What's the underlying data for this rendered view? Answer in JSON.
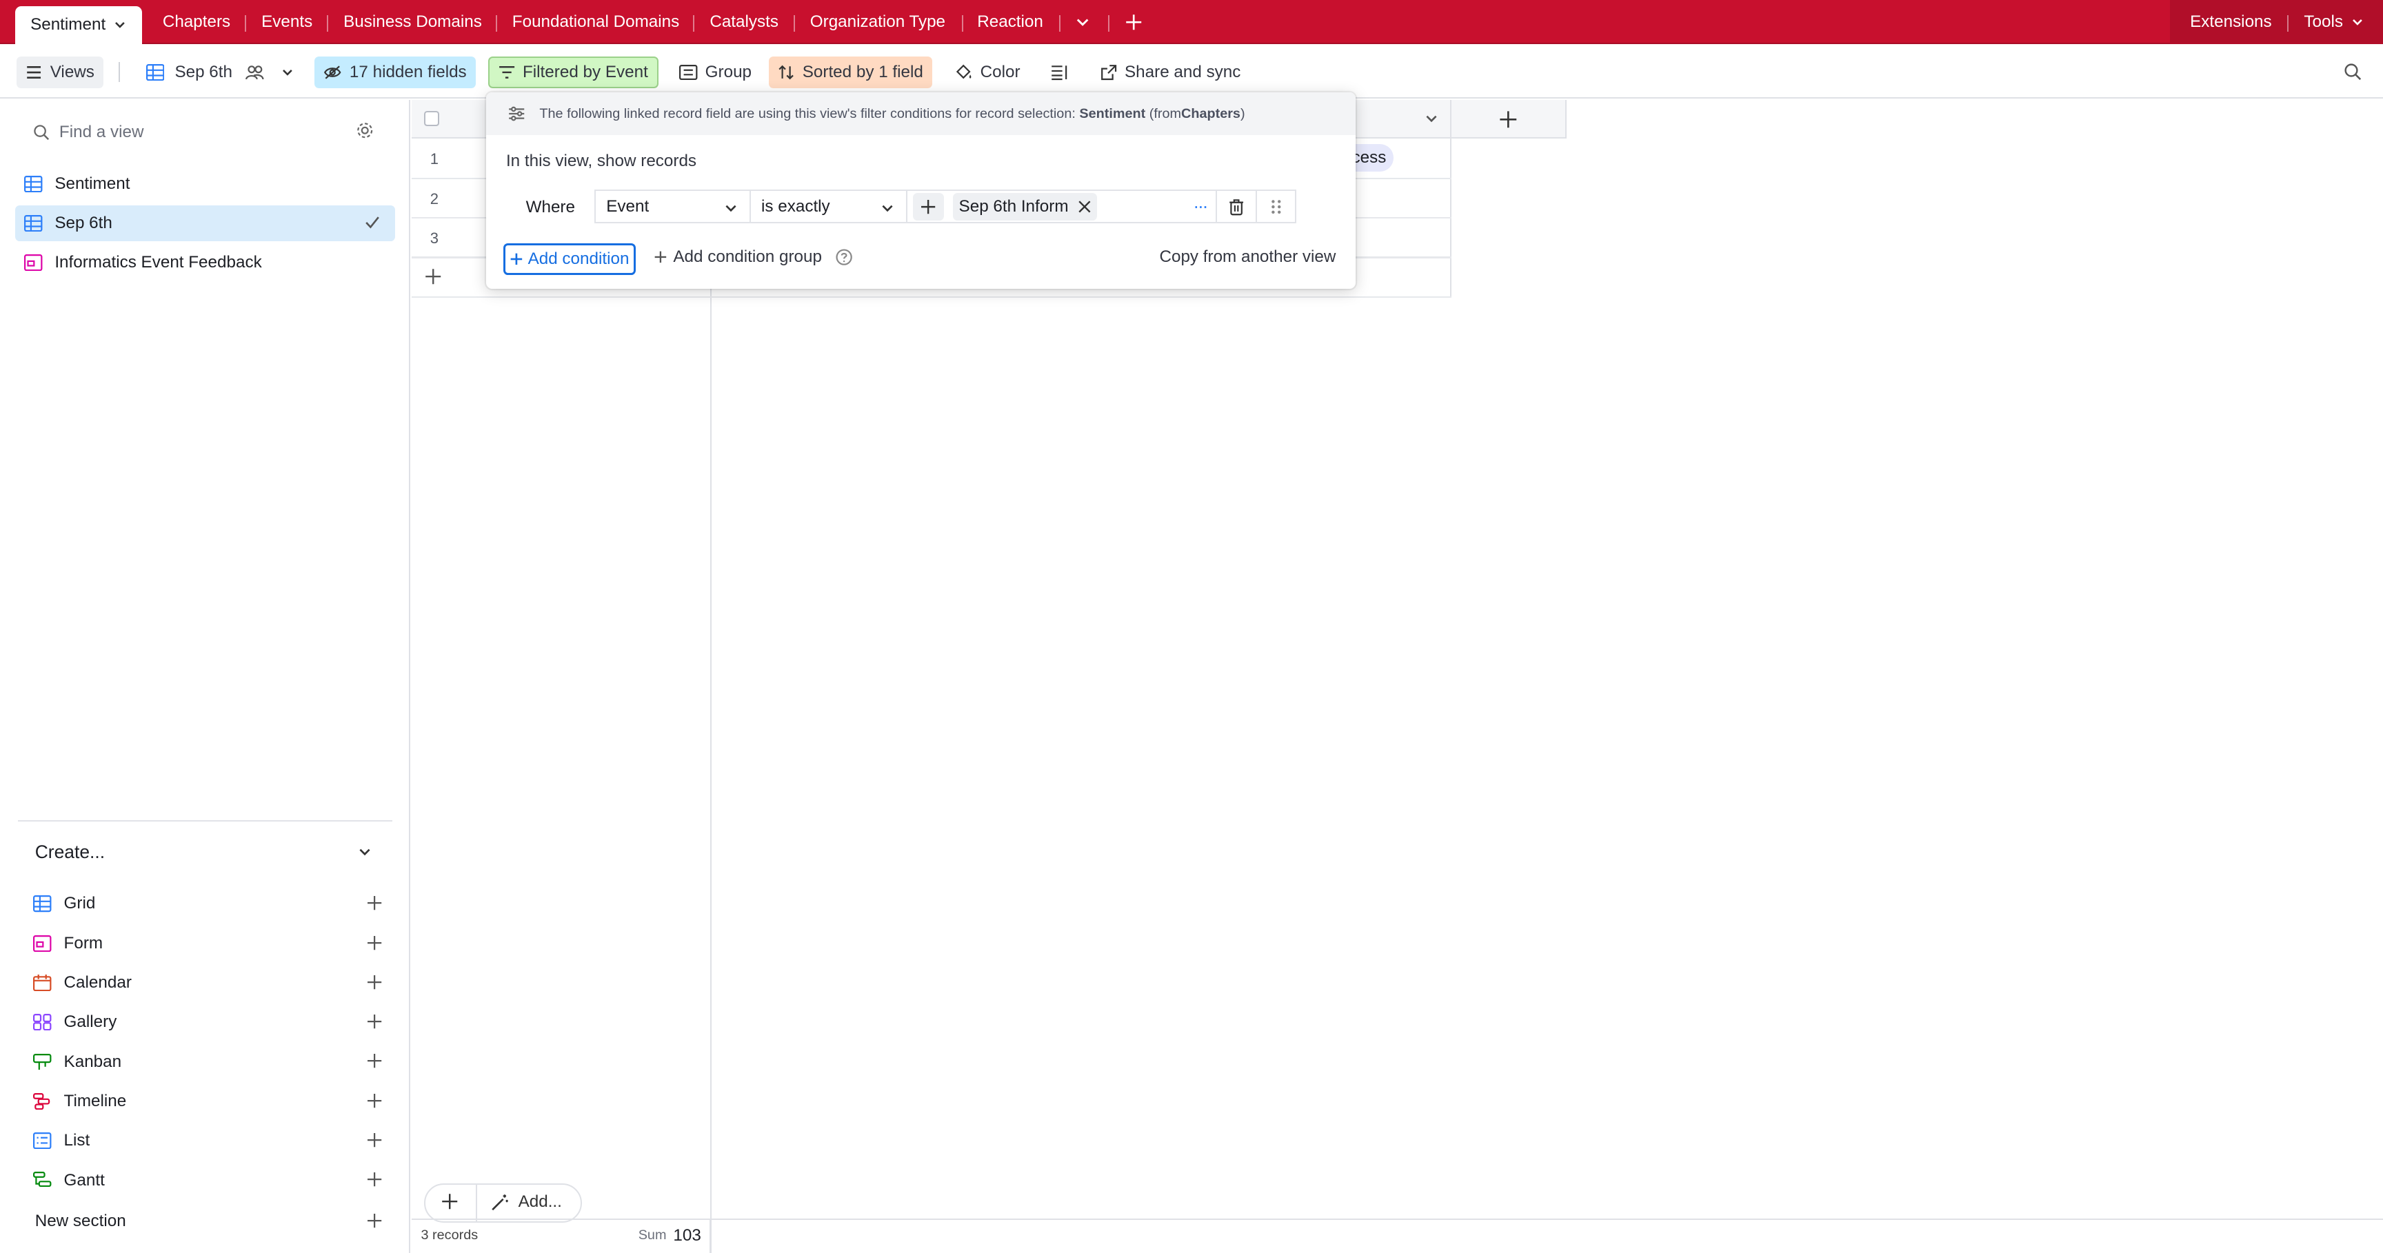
{
  "tabs": {
    "active": "Sentiment",
    "items": [
      "Chapters",
      "Events",
      "Business Domains",
      "Foundational Domains",
      "Catalysts",
      "Organization Type",
      "Reaction"
    ],
    "extensions": "Extensions",
    "tools": "Tools"
  },
  "toolbar": {
    "views": "Views",
    "current_view": "Sep 6th",
    "hidden_fields": "17 hidden fields",
    "filtered": "Filtered by Event",
    "group": "Group",
    "sorted": "Sorted by 1 field",
    "color": "Color",
    "share": "Share and sync"
  },
  "sidebar": {
    "search_placeholder": "Find a view",
    "views": [
      {
        "label": "Sentiment",
        "icon": "grid-icon",
        "selected": false
      },
      {
        "label": "Sep 6th",
        "icon": "grid-icon",
        "selected": true
      },
      {
        "label": "Informatics Event Feedback",
        "icon": "form-icon",
        "selected": false
      }
    ],
    "create_label": "Create...",
    "create_items": [
      {
        "label": "Grid",
        "icon": "grid-icon",
        "color": "#2d7ff9"
      },
      {
        "label": "Form",
        "icon": "form-icon",
        "color": "#dd04a8"
      },
      {
        "label": "Calendar",
        "icon": "calendar-icon",
        "color": "#d74d26"
      },
      {
        "label": "Gallery",
        "icon": "gallery-icon",
        "color": "#8b46ff"
      },
      {
        "label": "Kanban",
        "icon": "kanban-icon",
        "color": "#048a0e"
      },
      {
        "label": "Timeline",
        "icon": "timeline-icon",
        "color": "#dc043b"
      },
      {
        "label": "List",
        "icon": "list-icon",
        "color": "#2d7ff9"
      },
      {
        "label": "Gantt",
        "icon": "gantt-icon",
        "color": "#048a0e"
      }
    ],
    "new_section": "New section"
  },
  "grid": {
    "rows": [
      "1",
      "2",
      "3"
    ],
    "cell_fragment": "ccess",
    "add_label": "Add...",
    "records": "3 records",
    "sum_label": "Sum",
    "sum_value": "103"
  },
  "filter_popover": {
    "notice_prefix": "The following linked record field are using this view's filter conditions for record selection:",
    "notice_field": "Sentiment",
    "notice_from": "(from",
    "notice_table": "Chapters",
    "notice_close": ")",
    "heading": "In this view, show records",
    "where": "Where",
    "field": "Event",
    "operator": "is exactly",
    "value_chip": "Sep 6th Inform",
    "add_condition": "Add condition",
    "add_condition_group": "Add condition group",
    "copy": "Copy from another view"
  },
  "colors": {
    "brand": "#c8102e",
    "hidden_bg": "#c4ecff",
    "filter_bg": "#d1f7c4",
    "sort_bg": "#ffdac2",
    "selected_view_bg": "#d9ecfb",
    "link_blue": "#166ee1"
  }
}
